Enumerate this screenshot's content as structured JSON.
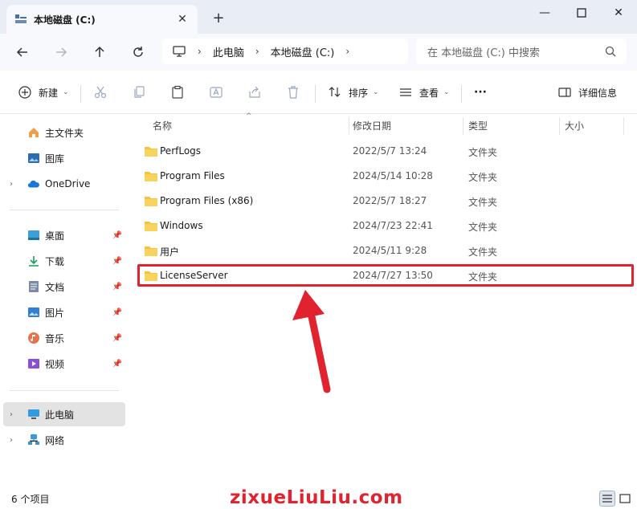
{
  "window": {
    "tab_title": "本地磁盘 (C:)",
    "new_tab_symbol": "+",
    "minimize_symbol": "—",
    "maximize_symbol": "☐",
    "close_symbol": "✕"
  },
  "nav": {
    "breadcrumbs": [
      "此电脑",
      "本地磁盘 (C:)"
    ],
    "search_placeholder": "在 本地磁盘 (C:) 中搜索"
  },
  "toolbar": {
    "new_label": "新建",
    "sort_label": "排序",
    "view_label": "查看",
    "more_label": "···",
    "details_label": "详细信息"
  },
  "sidebar": {
    "top_items": [
      {
        "label": "主文件夹",
        "icon": "home-icon"
      },
      {
        "label": "图库",
        "icon": "gallery-icon"
      },
      {
        "label": "OneDrive",
        "icon": "cloud-icon"
      }
    ],
    "quick_items": [
      {
        "label": "桌面",
        "icon": "desktop-icon"
      },
      {
        "label": "下载",
        "icon": "download-icon"
      },
      {
        "label": "文档",
        "icon": "document-icon"
      },
      {
        "label": "图片",
        "icon": "picture-icon"
      },
      {
        "label": "音乐",
        "icon": "music-icon"
      },
      {
        "label": "视频",
        "icon": "video-icon"
      }
    ],
    "device_items": [
      {
        "label": "此电脑",
        "icon": "computer-icon",
        "selected": true
      },
      {
        "label": "网络",
        "icon": "network-icon"
      }
    ]
  },
  "columns": {
    "name": "名称",
    "modified": "修改日期",
    "type": "类型",
    "size": "大小"
  },
  "files": [
    {
      "name": "PerfLogs",
      "modified": "2022/5/7 13:24",
      "type": "文件夹"
    },
    {
      "name": "Program Files",
      "modified": "2024/5/14 10:28",
      "type": "文件夹"
    },
    {
      "name": "Program Files (x86)",
      "modified": "2022/5/7 18:27",
      "type": "文件夹"
    },
    {
      "name": "Windows",
      "modified": "2024/7/23 22:41",
      "type": "文件夹"
    },
    {
      "name": "用户",
      "modified": "2024/5/11 9:28",
      "type": "文件夹"
    },
    {
      "name": "LicenseServer",
      "modified": "2024/7/27 13:50",
      "type": "文件夹"
    }
  ],
  "status": {
    "item_count": "6 个项目",
    "watermark": "zixueLiuLiu.com"
  },
  "colors": {
    "accent_red": "#e0232e",
    "folder_yellow": "#f5c242"
  }
}
